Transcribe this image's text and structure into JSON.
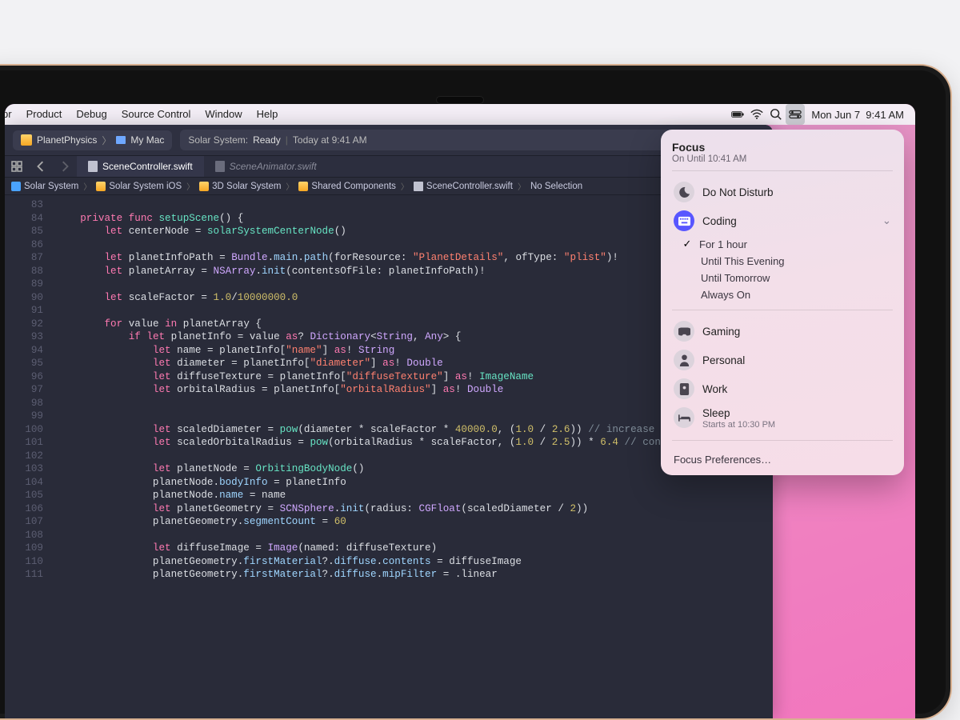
{
  "menubar": {
    "items": [
      "pr",
      "Product",
      "Debug",
      "Source Control",
      "Window",
      "Help"
    ],
    "date": "Mon Jun 7",
    "time": "9:41 AM"
  },
  "toolbar": {
    "project": "PlanetPhysics",
    "target": "My Mac",
    "status_prefix": "Solar System:",
    "status_word": "Ready",
    "status_time": "Today at 9:41 AM"
  },
  "tabs": {
    "active": "SceneController.swift",
    "inactive": "SceneAnimator.swift"
  },
  "jumpbar": [
    "Solar System",
    "Solar System iOS",
    "3D Solar System",
    "Shared Components",
    "SceneController.swift",
    "No Selection"
  ],
  "focus": {
    "title": "Focus",
    "subtitle": "On Until 10:41 AM",
    "dnd": "Do Not Disturb",
    "coding": "Coding",
    "durations": [
      "For 1 hour",
      "Until This Evening",
      "Until Tomorrow",
      "Always On"
    ],
    "gaming": "Gaming",
    "personal": "Personal",
    "work": "Work",
    "sleep": "Sleep",
    "sleep_sub": "Starts at 10:30 PM",
    "prefs": "Focus Preferences…"
  },
  "code": {
    "first_line": 83,
    "lines": [
      "",
      "    <kw>private</kw> <kw>func</kw> <fn>setupScene</fn>() {",
      "        <kw>let</kw> centerNode = <fn>solarSystemCenterNode</fn>()",
      "",
      "        <kw>let</kw> planetInfoPath = <cls>Bundle</cls>.<prop>main</prop>.<prop>path</prop>(forResource: <str>\"PlanetDetails\"</str>, ofType: <str>\"plist\"</str>)!",
      "        <kw>let</kw> planetArray = <cls>NSArray</cls>.<prop>init</prop>(contentsOfFile: planetInfoPath)!",
      "",
      "        <kw>let</kw> scaleFactor = <num>1.0</num>/<num>10000000.0</num>",
      "",
      "        <kw>for</kw> value <kw>in</kw> planetArray {",
      "            <kw>if</kw> <kw>let</kw> planetInfo = value <kw>as</kw>? <cls>Dictionary</cls>&lt;<cls>String</cls>, <cls>Any</cls>&gt; {",
      "                <kw>let</kw> name = planetInfo[<str>\"name\"</str>] <kw>as</kw>! <cls>String</cls>",
      "                <kw>let</kw> diameter = planetInfo[<str>\"diameter\"</str>] <kw>as</kw>! <cls>Double</cls>",
      "                <kw>let</kw> diffuseTexture = planetInfo[<str>\"diffuseTexture\"</str>] <kw>as</kw>! <fn>ImageName</fn>",
      "                <kw>let</kw> orbitalRadius = planetInfo[<str>\"orbitalRadius\"</str>] <kw>as</kw>! <cls>Double</cls>",
      "",
      "",
      "                <kw>let</kw> scaledDiameter = <fn>pow</fn>(diameter * scaleFactor * <num>40000.0</num>, (<num>1.0</num> / <num>2.6</num>)) <cmt>// increase planet size</cmt>",
      "                <kw>let</kw> scaledOrbitalRadius = <fn>pow</fn>(orbitalRadius * scaleFactor, (<num>1.0</num> / <num>2.5</num>)) * <num>6.4</num> <cmt>// condense the space</cmt>",
      "",
      "                <kw>let</kw> planetNode = <fn>OrbitingBodyNode</fn>()",
      "                planetNode.<prop>bodyInfo</prop> = planetInfo",
      "                planetNode.<prop>name</prop> = name",
      "                <kw>let</kw> planetGeometry = <cls>SCNSphere</cls>.<prop>init</prop>(radius: <cls>CGFloat</cls>(scaledDiameter / <num>2</num>))",
      "                planetGeometry.<prop>segmentCount</prop> = <num>60</num>",
      "",
      "                <kw>let</kw> diffuseImage = <cls>Image</cls>(named: diffuseTexture)",
      "                planetGeometry.<prop>firstMaterial</prop>?.<prop>diffuse</prop>.<prop>contents</prop> = diffuseImage",
      "                planetGeometry.<prop>firstMaterial</prop>?.<prop>diffuse</prop>.<prop>mipFilter</prop> = .linear"
    ]
  }
}
